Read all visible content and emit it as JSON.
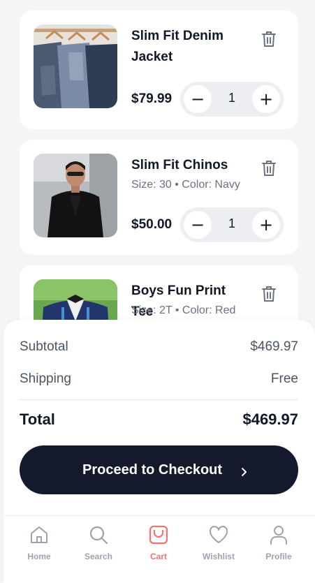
{
  "cart": {
    "items": [
      {
        "name_line1": "Slim Fit Denim",
        "name_line2": "Jacket",
        "meta": "",
        "price": "$79.99",
        "qty": "1",
        "image": "denim-jackets-on-hangers"
      },
      {
        "name_line1": "Slim Fit Chinos",
        "name_line2": "",
        "meta": "Size: 30 • Color: Navy",
        "price": "$50.00",
        "qty": "1",
        "image": "man-in-black-suit"
      },
      {
        "name_line1": "Boys Fun Print Tee",
        "name_line2": "",
        "meta": "Size: 2T • Color: Red",
        "price": "",
        "qty": "",
        "image": "boy-in-navy-cardigan"
      }
    ],
    "controls": {
      "minus": "−",
      "plus": "+"
    }
  },
  "summary": {
    "subtotal_label": "Subtotal",
    "subtotal_value": "$469.97",
    "shipping_label": "Shipping",
    "shipping_value": "Free",
    "total_label": "Total",
    "total_value": "$469.97",
    "checkout_label": "Proceed to Checkout",
    "checkout_icon": "›"
  },
  "tabs": [
    {
      "label": "Home",
      "icon": "home-icon"
    },
    {
      "label": "Search",
      "icon": "search-icon"
    },
    {
      "label": "Cart",
      "icon": "cart-bag-icon",
      "active": true
    },
    {
      "label": "Wishlist",
      "icon": "heart-icon"
    },
    {
      "label": "Profile",
      "icon": "user-icon"
    }
  ],
  "colors": {
    "accent": "#f87171",
    "dark": "#141a2b",
    "muted": "#9ca3af"
  }
}
